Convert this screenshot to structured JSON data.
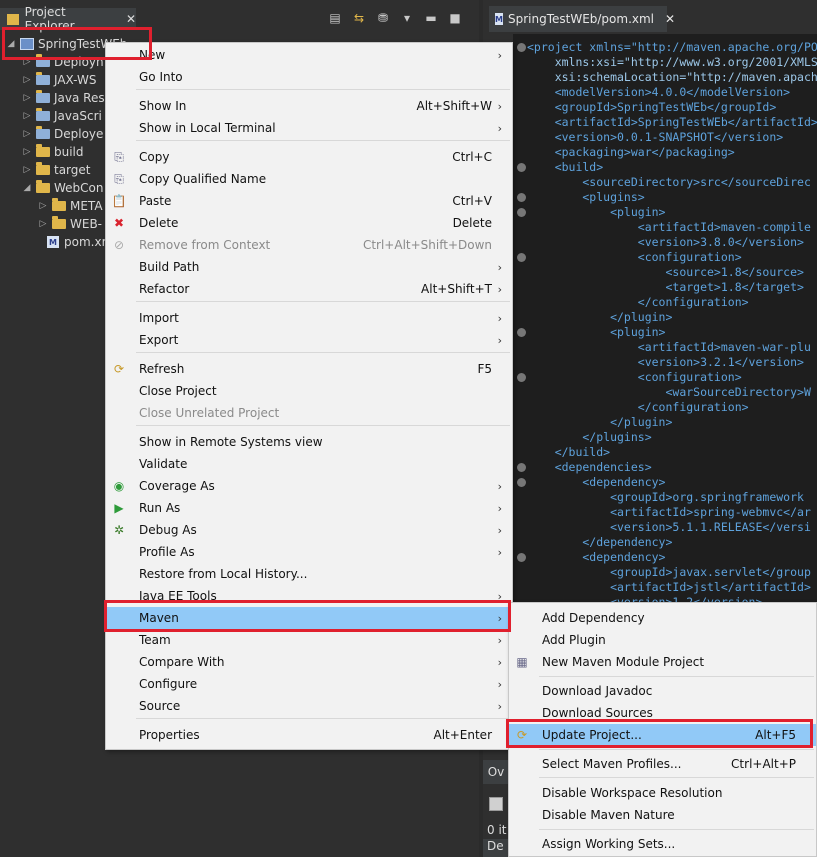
{
  "explorer": {
    "tab_title": "Project Explorer",
    "tree": [
      {
        "label": "SpringTestWEb",
        "kind": "project"
      },
      {
        "label": "Deployn",
        "kind": "item"
      },
      {
        "label": "JAX-WS",
        "kind": "item"
      },
      {
        "label": "Java Res",
        "kind": "item"
      },
      {
        "label": "JavaScri",
        "kind": "item"
      },
      {
        "label": "Deploye",
        "kind": "item"
      },
      {
        "label": "build",
        "kind": "folder"
      },
      {
        "label": "target",
        "kind": "folder"
      },
      {
        "label": "WebCon",
        "kind": "folder"
      },
      {
        "label": "META",
        "kind": "folder"
      },
      {
        "label": "WEB-",
        "kind": "folder"
      },
      {
        "label": "pom.xml",
        "kind": "file"
      }
    ]
  },
  "editor": {
    "tab_title": "SpringTestWEb/pom.xml",
    "bottom_tab_a": "Ov",
    "bottom_text_b": "0 it",
    "bottom_text_c": "De",
    "lines": [
      [
        "<project xmlns=\"http://maven.apache.org/PO"
      ],
      [
        "    xmlns:xsi=\"http://www.w3.org/2001/XMLS"
      ],
      [
        "    xsi:schemaLocation=\"http://maven.apach"
      ],
      [
        "    <modelVersion>4.0.0</modelVersion>"
      ],
      [
        "    <groupId>SpringTestWEb</groupId>"
      ],
      [
        "    <artifactId>SpringTestWEb</artifactId>"
      ],
      [
        "    <version>0.0.1-SNAPSHOT</version>"
      ],
      [
        "    <packaging>war</packaging>"
      ],
      [
        "    <build>"
      ],
      [
        "        <sourceDirectory>src</sourceDirec"
      ],
      [
        "        <plugins>"
      ],
      [
        "            <plugin>"
      ],
      [
        "                <artifactId>maven-compile"
      ],
      [
        "                <version>3.8.0</version>"
      ],
      [
        "                <configuration>"
      ],
      [
        "                    <source>1.8</source>"
      ],
      [
        "                    <target>1.8</target>"
      ],
      [
        "                </configuration>"
      ],
      [
        "            </plugin>"
      ],
      [
        "            <plugin>"
      ],
      [
        "                <artifactId>maven-war-plu"
      ],
      [
        "                <version>3.2.1</version>"
      ],
      [
        "                <configuration>"
      ],
      [
        "                    <warSourceDirectory>W"
      ],
      [
        "                </configuration>"
      ],
      [
        "            </plugin>"
      ],
      [
        "        </plugins>"
      ],
      [
        "    </build>"
      ],
      [
        "    <dependencies>"
      ],
      [
        "        <dependency>"
      ],
      [
        "            <groupId>org.springframework"
      ],
      [
        "            <artifactId>spring-webmvc</ar"
      ],
      [
        "            <version>5.1.1.RELEASE</versi"
      ],
      [
        "        </dependency>"
      ],
      [
        "        <dependency>"
      ],
      [
        "            <groupId>javax.servlet</group"
      ],
      [
        "            <artifactId>jstl</artifactId>"
      ],
      [
        "            <version>1.2</version>"
      ]
    ]
  },
  "context_menu": {
    "items": [
      {
        "label": "New",
        "arrow": true
      },
      {
        "label": "Go Into"
      },
      {
        "sep": true
      },
      {
        "label": "Show In",
        "shortcut": "Alt+Shift+W",
        "arrow": true
      },
      {
        "label": "Show in Local Terminal",
        "arrow": true
      },
      {
        "sep": true
      },
      {
        "label": "Copy",
        "shortcut": "Ctrl+C",
        "icon": "copy-icon"
      },
      {
        "label": "Copy Qualified Name",
        "icon": "copy-qualified-icon"
      },
      {
        "label": "Paste",
        "shortcut": "Ctrl+V",
        "icon": "paste-icon"
      },
      {
        "label": "Delete",
        "shortcut": "Delete",
        "icon": "delete-icon"
      },
      {
        "label": "Remove from Context",
        "shortcut": "Ctrl+Alt+Shift+Down",
        "disabled": true,
        "icon": "remove-context-icon"
      },
      {
        "label": "Build Path",
        "arrow": true
      },
      {
        "label": "Refactor",
        "shortcut": "Alt+Shift+T",
        "arrow": true
      },
      {
        "sep": true
      },
      {
        "label": "Import",
        "arrow": true
      },
      {
        "label": "Export",
        "arrow": true
      },
      {
        "sep": true
      },
      {
        "label": "Refresh",
        "shortcut": "F5",
        "icon": "refresh-icon"
      },
      {
        "label": "Close Project"
      },
      {
        "label": "Close Unrelated Project",
        "disabled": true
      },
      {
        "sep": true
      },
      {
        "label": "Show in Remote Systems view"
      },
      {
        "label": "Validate"
      },
      {
        "label": "Coverage As",
        "arrow": true,
        "icon": "coverage-icon"
      },
      {
        "label": "Run As",
        "arrow": true,
        "icon": "run-icon"
      },
      {
        "label": "Debug As",
        "arrow": true,
        "icon": "debug-icon"
      },
      {
        "label": "Profile As",
        "arrow": true
      },
      {
        "label": "Restore from Local History..."
      },
      {
        "label": "Java EE Tools",
        "arrow": true
      },
      {
        "label": "Maven",
        "arrow": true,
        "highlight": true
      },
      {
        "label": "Team",
        "arrow": true
      },
      {
        "label": "Compare With",
        "arrow": true
      },
      {
        "label": "Configure",
        "arrow": true
      },
      {
        "label": "Source",
        "arrow": true
      },
      {
        "sep": true
      },
      {
        "label": "Properties",
        "shortcut": "Alt+Enter"
      }
    ]
  },
  "maven_menu": {
    "items": [
      {
        "label": "Add Dependency"
      },
      {
        "label": "Add Plugin"
      },
      {
        "label": "New Maven Module Project",
        "icon": "maven-module-icon"
      },
      {
        "sep": true
      },
      {
        "label": "Download Javadoc"
      },
      {
        "label": "Download Sources"
      },
      {
        "label": "Update Project...",
        "shortcut": "Alt+F5",
        "highlight": true,
        "icon": "update-project-icon"
      },
      {
        "sep": true
      },
      {
        "label": "Select Maven Profiles...",
        "shortcut": "Ctrl+Alt+P"
      },
      {
        "sep": true
      },
      {
        "label": "Disable Workspace Resolution"
      },
      {
        "label": "Disable Maven Nature"
      },
      {
        "sep": true
      },
      {
        "label": "Assign Working Sets..."
      }
    ]
  },
  "colors": {
    "highlight": "#91c9f7",
    "callout_border": "#e0202e",
    "menu_bg": "#f2f2f2"
  }
}
